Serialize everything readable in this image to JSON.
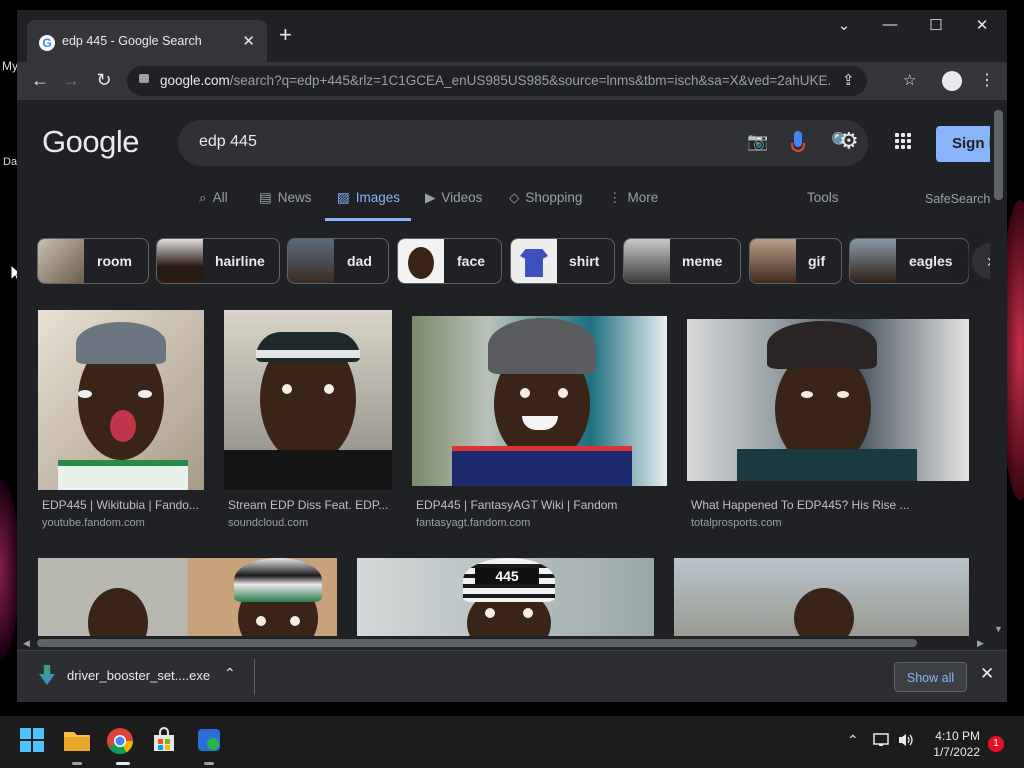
{
  "desktop": {
    "labels": [
      "My",
      "Da"
    ]
  },
  "browser": {
    "tab_title": "edp 445 - Google Search",
    "new_tab_symbol": "+",
    "window_controls": {
      "dropdown": "⌄",
      "minimize": "—",
      "maximize": "☐",
      "close": "✕"
    },
    "url_host": "google.com",
    "url_path": "/search?q=edp+445&rlz=1C1GCEA_enUS985US985&source=lnms&tbm=isch&sa=X&ved=2ahUKE..."
  },
  "google": {
    "logo": "Google",
    "query": "edp 445",
    "sign_in": "Sign in",
    "nav": [
      {
        "label": "All",
        "icon": "search-icon"
      },
      {
        "label": "News",
        "icon": "news-icon"
      },
      {
        "label": "Images",
        "icon": "images-icon",
        "active": true
      },
      {
        "label": "Videos",
        "icon": "video-icon"
      },
      {
        "label": "Shopping",
        "icon": "tag-icon"
      },
      {
        "label": "More",
        "icon": "more-vertical-icon"
      }
    ],
    "tools": "Tools",
    "safesearch": "SafeSearch",
    "chips": [
      "room",
      "hairline",
      "dad",
      "face",
      "shirt",
      "meme",
      "gif",
      "eagles"
    ],
    "results": [
      {
        "title": "EDP445 | Wikitubia | Fando...",
        "source": "youtube.fandom.com"
      },
      {
        "title": "Stream EDP Diss Feat. EDP...",
        "source": "soundcloud.com"
      },
      {
        "title": "EDP445 | FantasyAGT Wiki | Fandom",
        "source": "fantasyagt.fandom.com"
      },
      {
        "title": "What Happened To EDP445? His Rise ...",
        "source": "totalprosports.com"
      }
    ],
    "row2_hat_text": "445"
  },
  "downloads": {
    "file_name": "driver_booster_set....exe",
    "show_all": "Show all"
  },
  "taskbar": {
    "time": "4:10 PM",
    "date": "1/7/2022",
    "notification_count": "1"
  },
  "colors": {
    "page_bg": "#202124",
    "accent": "#8ab4f8",
    "chrome_toolbar": "#35363a"
  }
}
